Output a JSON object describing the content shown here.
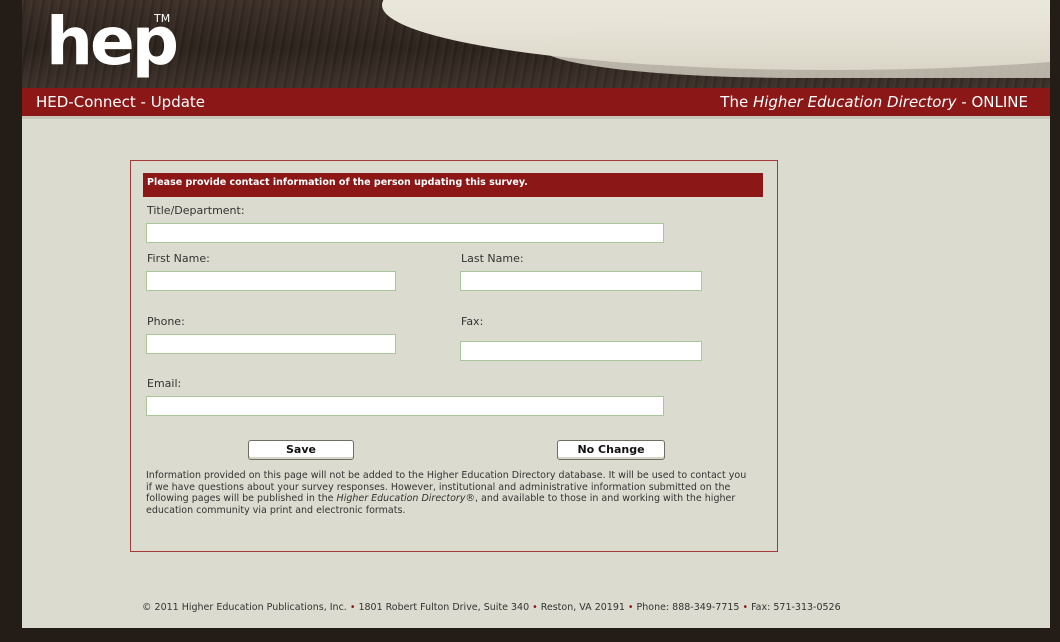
{
  "header": {
    "logo_text": "hep",
    "tm": "TM",
    "app_title": "HED-Connect - Update",
    "tagline_prefix": "The ",
    "tagline_italic": "Higher Education Directory",
    "tagline_suffix": " - ONLINE"
  },
  "form": {
    "heading": "Please provide contact information of the person updating this survey.",
    "fields": {
      "title_department": {
        "label": "Title/Department:",
        "value": ""
      },
      "first_name": {
        "label": "First Name:",
        "value": ""
      },
      "last_name": {
        "label": "Last Name:",
        "value": ""
      },
      "phone": {
        "label": "Phone:",
        "value": ""
      },
      "fax": {
        "label": "Fax:",
        "value": ""
      },
      "email": {
        "label": "Email:",
        "value": ""
      }
    },
    "buttons": {
      "save": "Save",
      "no_change": "No Change"
    },
    "info": {
      "part1": "Information provided on this page will not be added to the Higher Education Directory database. It will be used to contact you if we have questions about your survey responses. However, institutional and administrative information submitted on the following pages will be published in the ",
      "italic": "Higher Education Directory",
      "registered": "®",
      "part2": ", and available to those in and working with the higher education community via print and electronic formats."
    }
  },
  "footer": {
    "copyright": "© 2011 Higher Education Publications, Inc.",
    "address": "1801 Robert Fulton Drive, Suite 340",
    "city": "Reston, VA 20191",
    "phone": "Phone: 888-349-7715",
    "fax": "Fax: 571-313-0526",
    "separator": "•"
  },
  "colors": {
    "brand_red": "#8b1717",
    "page_bg": "#dcdbcf",
    "frame_dark": "#241c17"
  }
}
